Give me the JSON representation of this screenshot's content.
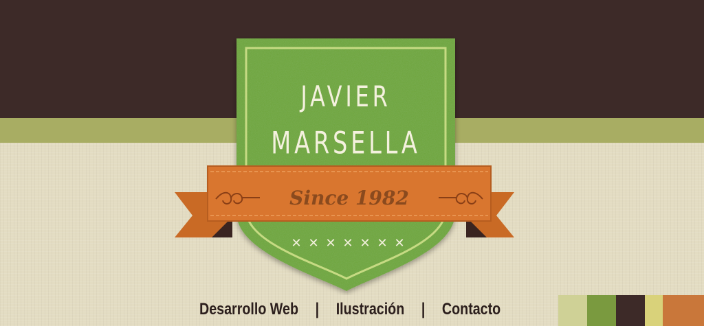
{
  "header": {
    "name_line1": "JAVIER",
    "name_line2": "MARSELLA",
    "since": "Since 1982",
    "stitches": [
      "✕",
      "✕",
      "✕",
      "✕",
      "✕",
      "✕",
      "✕"
    ]
  },
  "nav": {
    "items": [
      {
        "label": "Desarrollo Web"
      },
      {
        "label": "Ilustración"
      },
      {
        "label": "Contacto"
      }
    ],
    "separator": "|"
  },
  "palette": {
    "colors": [
      "#cfd196",
      "#7a9a3f",
      "#3d2a28",
      "#d9d27a",
      "#c9773a"
    ]
  },
  "colors": {
    "dark_band": "#3d2a28",
    "olive_band": "#a8ad63",
    "cream": "#e3dcc2",
    "grass": "#6ea43a",
    "ribbon": "#d9762f",
    "chalk": "#f4f1de"
  }
}
